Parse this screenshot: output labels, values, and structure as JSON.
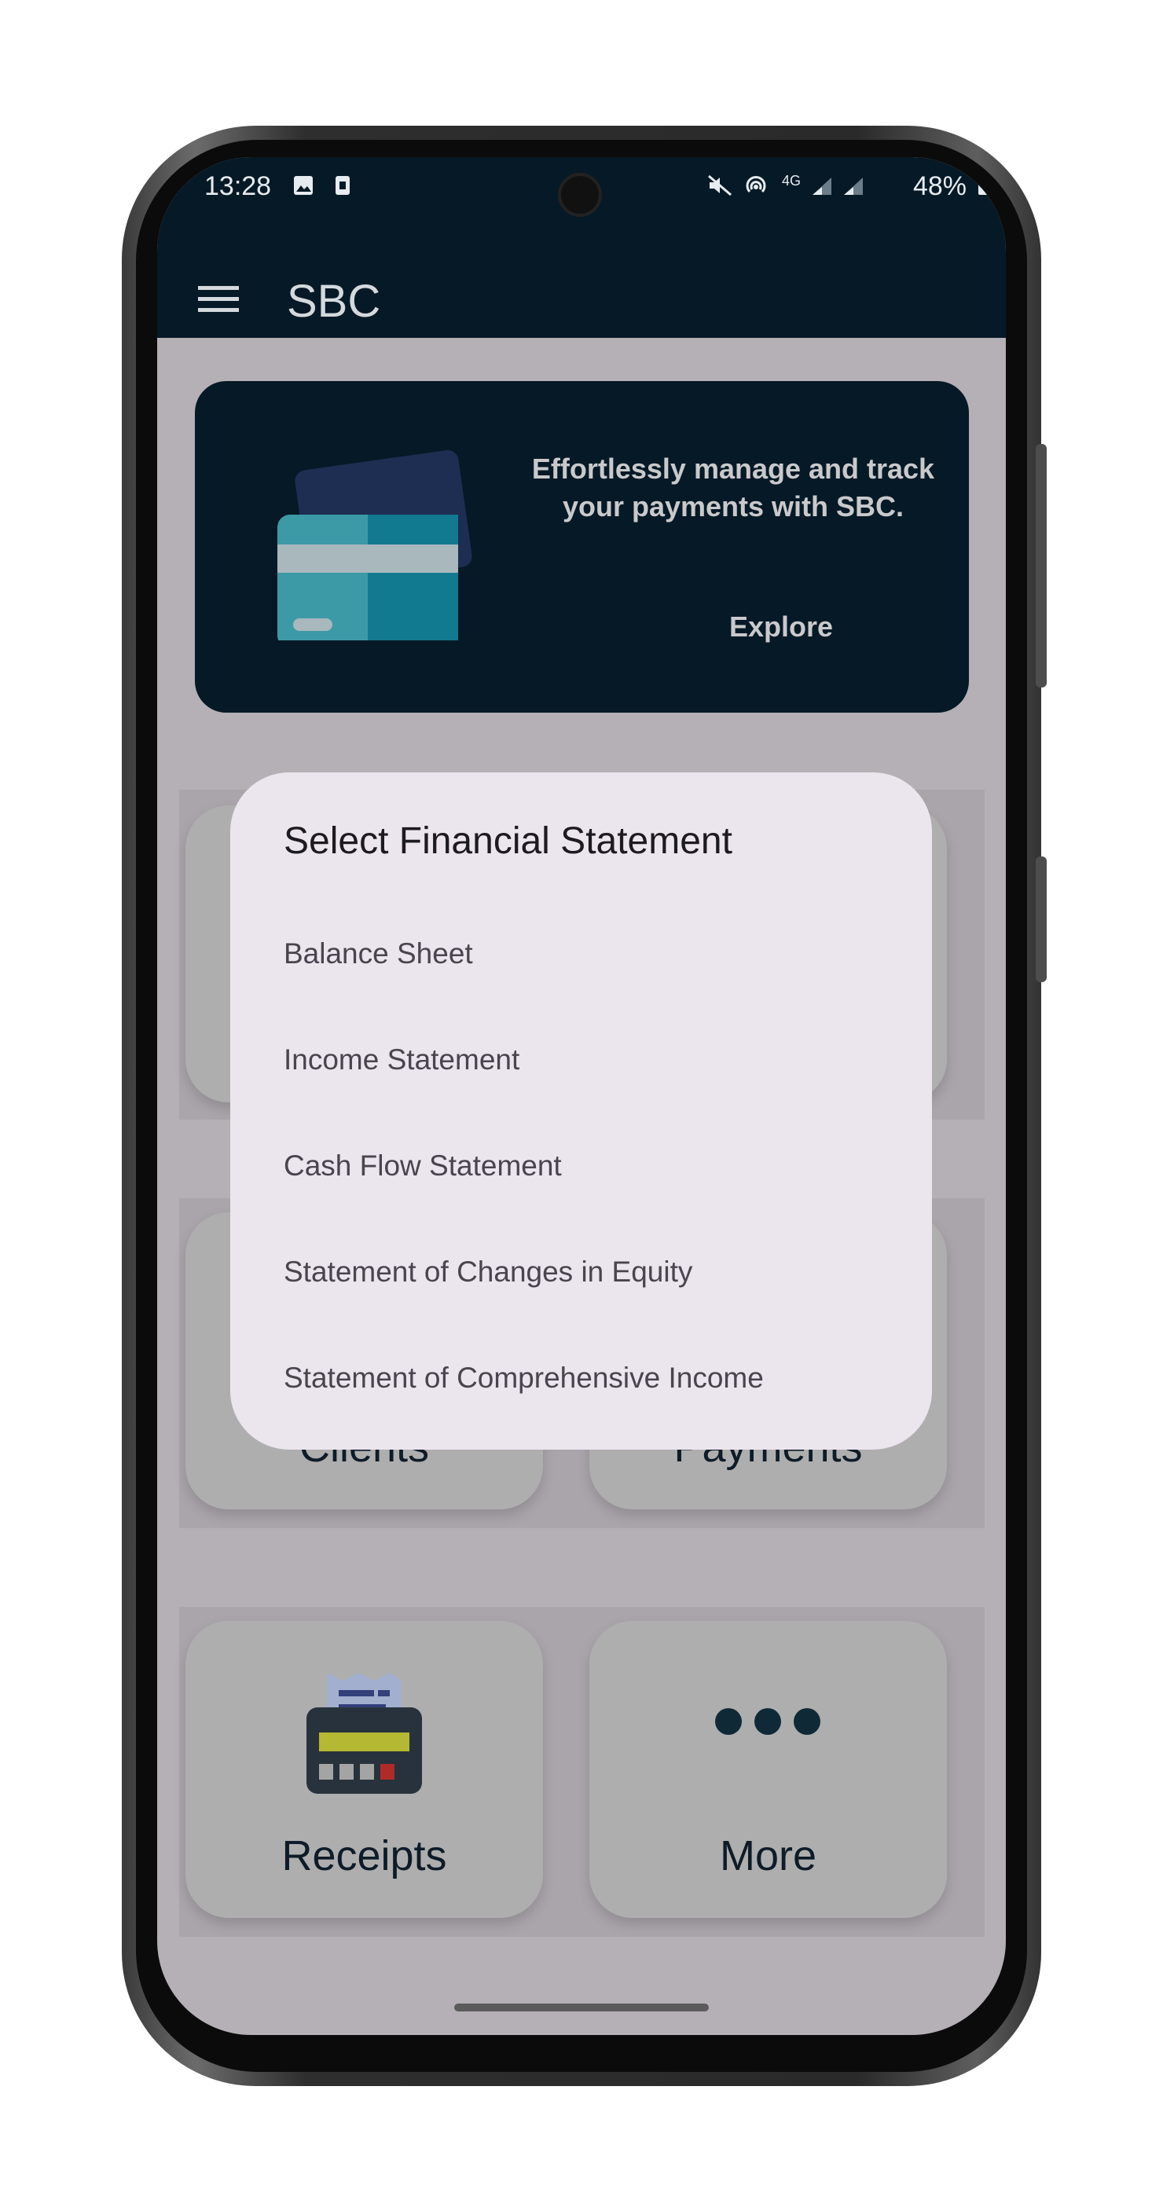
{
  "status_bar": {
    "time": "13:28",
    "network": "4G",
    "battery": "48%"
  },
  "app_bar": {
    "title": "SBC",
    "menu_icon": "hamburger-menu-icon"
  },
  "banner": {
    "text": "Effortlessly manage and track your payments with SBC.",
    "button_label": "Explore",
    "illustration_icon": "credit-card-icon"
  },
  "cards": [
    {
      "label": "Clients"
    },
    {
      "label": "Payments"
    },
    {
      "label": "Receipts",
      "icon": "receipt-printer-icon"
    },
    {
      "label": "More",
      "icon": "more-dots-icon"
    }
  ],
  "dialog": {
    "title": "Select Financial Statement",
    "options": [
      "Balance Sheet",
      "Income Statement",
      "Cash Flow Statement",
      "Statement of Changes in Equity",
      "Statement of Comprehensive Income"
    ]
  },
  "colors": {
    "primary_dark": "#061926",
    "scrim": "#b4b0b5",
    "dialog_bg": "#ebe5ee",
    "card_bg": "#aeaeae"
  }
}
